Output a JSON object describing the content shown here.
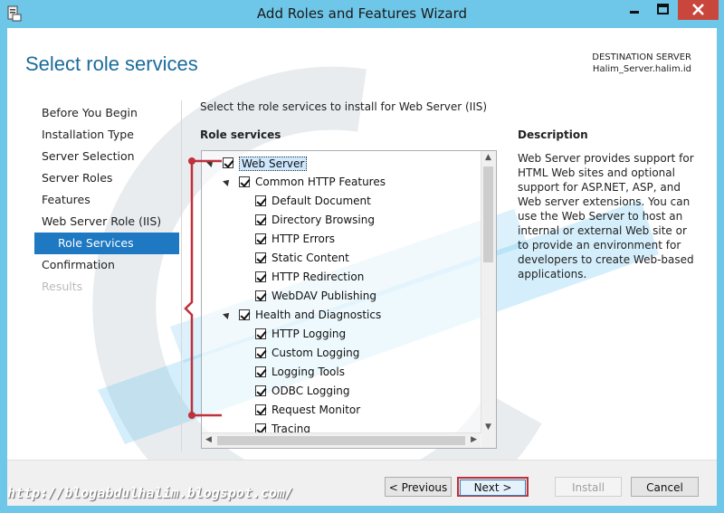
{
  "window": {
    "title": "Add Roles and Features Wizard"
  },
  "page": {
    "heading": "Select role services",
    "destination_label": "DESTINATION SERVER",
    "destination_server": "Halim_Server.halim.id"
  },
  "nav": {
    "items": [
      {
        "label": "Before You Begin",
        "state": "normal"
      },
      {
        "label": "Installation Type",
        "state": "normal"
      },
      {
        "label": "Server Selection",
        "state": "normal"
      },
      {
        "label": "Server Roles",
        "state": "normal"
      },
      {
        "label": "Features",
        "state": "normal"
      },
      {
        "label": "Web Server Role (IIS)",
        "state": "normal"
      },
      {
        "label": "Role Services",
        "state": "active"
      },
      {
        "label": "Confirmation",
        "state": "normal"
      },
      {
        "label": "Results",
        "state": "disabled"
      }
    ]
  },
  "main": {
    "instruction": "Select the role services to install for Web Server (IIS)",
    "role_services_label": "Role services",
    "tree": [
      {
        "label": "Web Server",
        "level": 0,
        "expandable": true,
        "checked": true,
        "selected": true
      },
      {
        "label": "Common HTTP Features",
        "level": 1,
        "expandable": true,
        "checked": true
      },
      {
        "label": "Default Document",
        "level": 2,
        "expandable": false,
        "checked": true
      },
      {
        "label": "Directory Browsing",
        "level": 2,
        "expandable": false,
        "checked": true
      },
      {
        "label": "HTTP Errors",
        "level": 2,
        "expandable": false,
        "checked": true
      },
      {
        "label": "Static Content",
        "level": 2,
        "expandable": false,
        "checked": true
      },
      {
        "label": "HTTP Redirection",
        "level": 2,
        "expandable": false,
        "checked": true
      },
      {
        "label": "WebDAV Publishing",
        "level": 2,
        "expandable": false,
        "checked": true
      },
      {
        "label": "Health and Diagnostics",
        "level": 1,
        "expandable": true,
        "checked": true
      },
      {
        "label": "HTTP Logging",
        "level": 2,
        "expandable": false,
        "checked": true
      },
      {
        "label": "Custom Logging",
        "level": 2,
        "expandable": false,
        "checked": true
      },
      {
        "label": "Logging Tools",
        "level": 2,
        "expandable": false,
        "checked": true
      },
      {
        "label": "ODBC Logging",
        "level": 2,
        "expandable": false,
        "checked": true
      },
      {
        "label": "Request Monitor",
        "level": 2,
        "expandable": false,
        "checked": true
      },
      {
        "label": "Tracing",
        "level": 2,
        "expandable": false,
        "checked": true
      }
    ]
  },
  "description": {
    "label": "Description",
    "text": "Web Server provides support for HTML Web sites and optional support for ASP.NET, ASP, and Web server extensions. You can use the Web Server to host an internal or external Web site or to provide an environment for developers to create Web-based applications."
  },
  "footer": {
    "previous_label": "< Previous",
    "next_label": "Next >",
    "install_label": "Install",
    "cancel_label": "Cancel"
  },
  "watermark_text": "http://blogabdulhalim.blogspot.com/",
  "colors": {
    "title_bar": "#6ec6e8",
    "heading": "#1b6b9c",
    "nav_active": "#1e78c2",
    "close_button": "#c9463d",
    "annotation_bracket": "#c0313b"
  },
  "icons": {
    "app": "server-manager-icon",
    "minimize": "minimize-icon",
    "maximize": "maximize-icon",
    "close": "close-icon"
  }
}
